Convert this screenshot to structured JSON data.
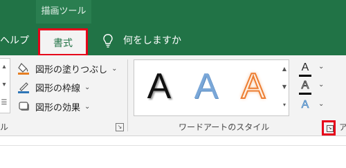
{
  "context_tab": {
    "label": "描画ツール"
  },
  "tabs": {
    "help": "ヘルプ",
    "format": "書式"
  },
  "tell_me": {
    "icon": "lightbulb-icon",
    "text": "何をしますか"
  },
  "shape_styles": {
    "commands": [
      {
        "label": "図形の塗りつぶし",
        "icon": "paint-bucket-icon"
      },
      {
        "label": "図形の枠線",
        "icon": "pen-outline-icon"
      },
      {
        "label": "図形の効果",
        "icon": "shape-effects-icon"
      }
    ],
    "group_label_cut": "ル"
  },
  "wordart": {
    "gallery": [
      "A",
      "A",
      "A"
    ],
    "group_label": "ワードアートのスタイル",
    "tools": [
      {
        "letter": "A",
        "bar_color": "#000000",
        "icon": "text-fill-icon"
      },
      {
        "letter": "A",
        "bar_color": "#000000",
        "icon": "text-outline-icon"
      },
      {
        "letter": "A",
        "bar_color": "#ffffff",
        "icon": "text-effects-icon"
      }
    ]
  },
  "next_group": {
    "label_cut": "ア"
  },
  "colors": {
    "ribbon": "#217346",
    "highlight": "#e6001a",
    "fill_accent": "#e67e22"
  }
}
